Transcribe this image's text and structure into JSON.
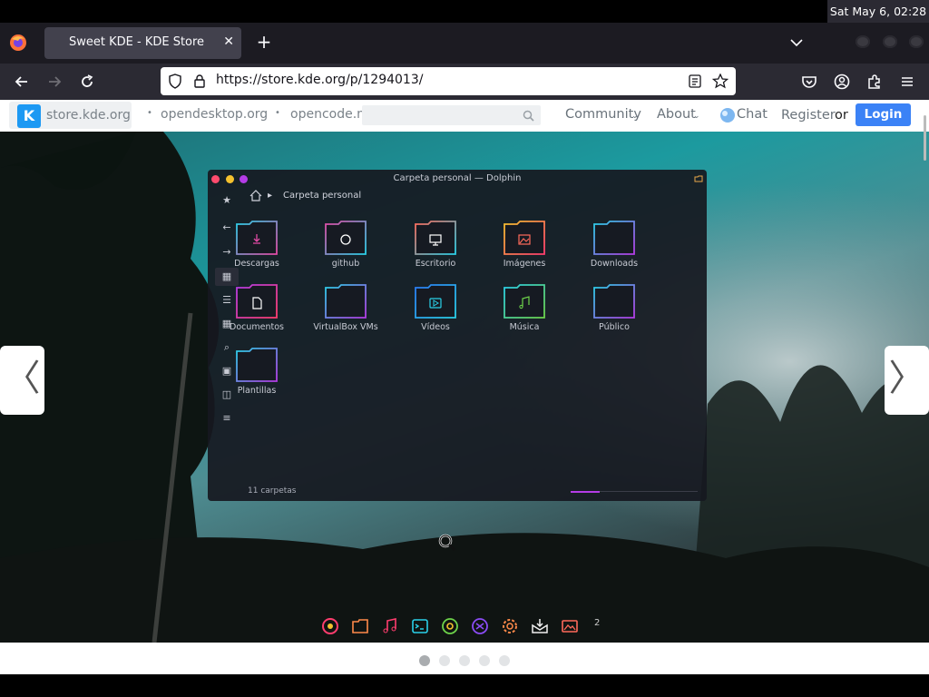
{
  "system": {
    "clock": "Sat May  6, 02:28"
  },
  "browser": {
    "tab_title": "Sweet KDE - KDE Store",
    "tab_close_glyph": "✕",
    "new_tab_glyph": "+",
    "url": "https://store.kde.org/p/1294013/"
  },
  "site": {
    "brand": "store.kde.org",
    "logo_letter": "K",
    "links": [
      "opendesktop.org",
      "opencode.ne"
    ],
    "nav": {
      "community": "Community",
      "about": "About",
      "chat": "Chat",
      "register": "Register",
      "or": "or",
      "login": "Login"
    }
  },
  "slideshow": {
    "prev_glyph": "〈",
    "next_glyph": "〉",
    "page_count": 5,
    "active_page": 1
  },
  "dolphin": {
    "title": "Carpeta personal — Dolphin",
    "breadcrumb": "Carpeta personal",
    "status": "11 carpetas",
    "folders": [
      {
        "label": "Descargas",
        "icon": "download"
      },
      {
        "label": "github",
        "icon": "github"
      },
      {
        "label": "Escritorio",
        "icon": "desktop"
      },
      {
        "label": "Imágenes",
        "icon": "image"
      },
      {
        "label": "Downloads",
        "icon": "plain"
      },
      {
        "label": "Documentos",
        "icon": "document"
      },
      {
        "label": "VirtualBox VMs",
        "icon": "plain"
      },
      {
        "label": "Vídeos",
        "icon": "video"
      },
      {
        "label": "Música",
        "icon": "music"
      },
      {
        "label": "Público",
        "icon": "plain"
      },
      {
        "label": "Plantillas",
        "icon": "plain"
      }
    ]
  },
  "dock": {
    "icons": [
      "firefox-icon",
      "folder-icon",
      "music-icon",
      "terminal-icon",
      "chrome-icon",
      "vscode-icon",
      "settings-icon",
      "installer-icon",
      "image-viewer-icon"
    ],
    "workspace_badge": "2"
  }
}
